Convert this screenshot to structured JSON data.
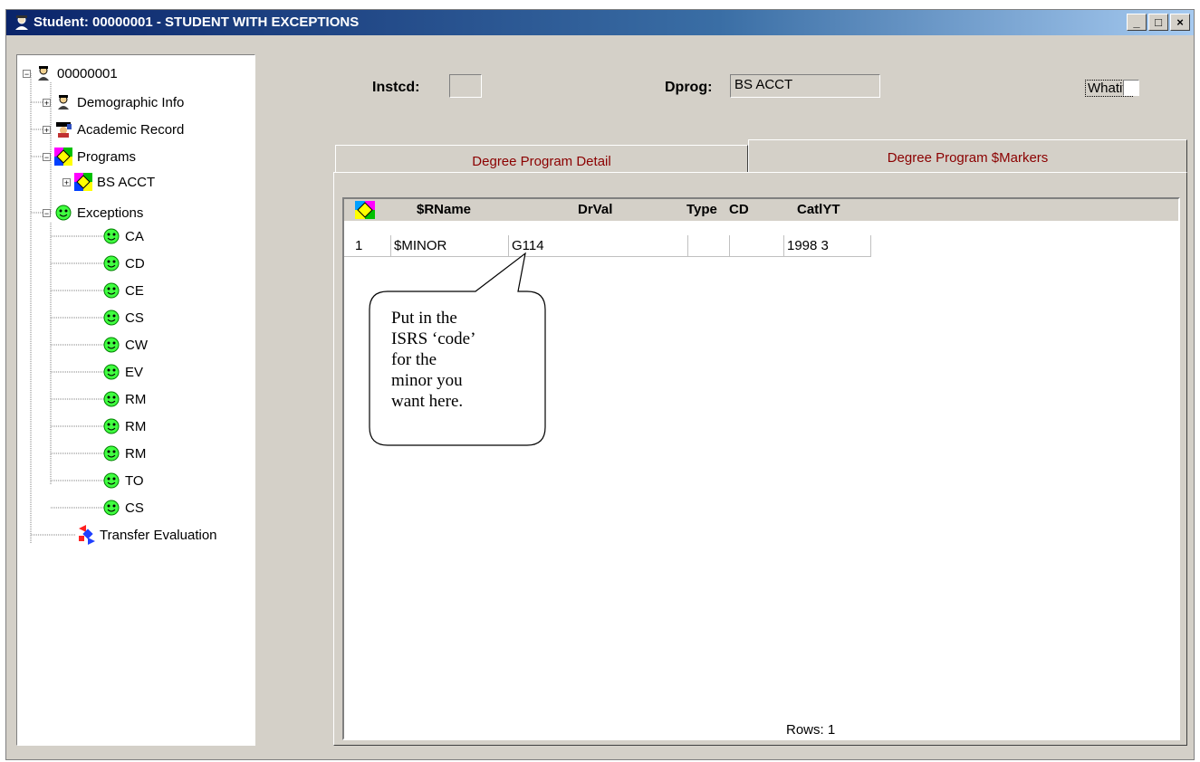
{
  "window": {
    "title": "Student: 00000001 - STUDENT WITH EXCEPTIONS",
    "buttons": {
      "minimize": "_",
      "maximize": "□",
      "close": "×"
    }
  },
  "tree": {
    "root": "00000001",
    "demographic": "Demographic Info",
    "academic": "Academic Record",
    "programs": "Programs",
    "program_item": "BS  ACCT",
    "exceptions": "Exceptions",
    "exception_items": [
      "CA",
      "CD",
      "CE",
      "CS",
      "CW",
      "EV",
      "RM",
      "RM",
      "RM",
      "TO",
      "CS"
    ],
    "transfer": "Transfer Evaluation"
  },
  "form": {
    "instcd_label": "Instcd:",
    "instcd_value": "",
    "dprog_label": "Dprog:",
    "dprog_value": "BS  ACCT",
    "whatif_label": "Whatif:",
    "whatif_checked": false
  },
  "tabs": [
    {
      "label": "Degree Program Detail",
      "active": false
    },
    {
      "label": "Degree Program $Markers",
      "active": true
    }
  ],
  "grid": {
    "headers": [
      "$RName",
      "DrVal",
      "Type",
      "CD",
      "CatlYT"
    ],
    "rows": [
      {
        "num": "1",
        "rname": "$MINOR",
        "drval": "G114",
        "type": "",
        "cd": "",
        "catlyt": "1998 3"
      }
    ],
    "footer": "Rows: 1"
  },
  "callout": {
    "lines": [
      "Put in the",
      "ISRS ‘code’",
      "for the",
      "minor you",
      "want here."
    ]
  }
}
